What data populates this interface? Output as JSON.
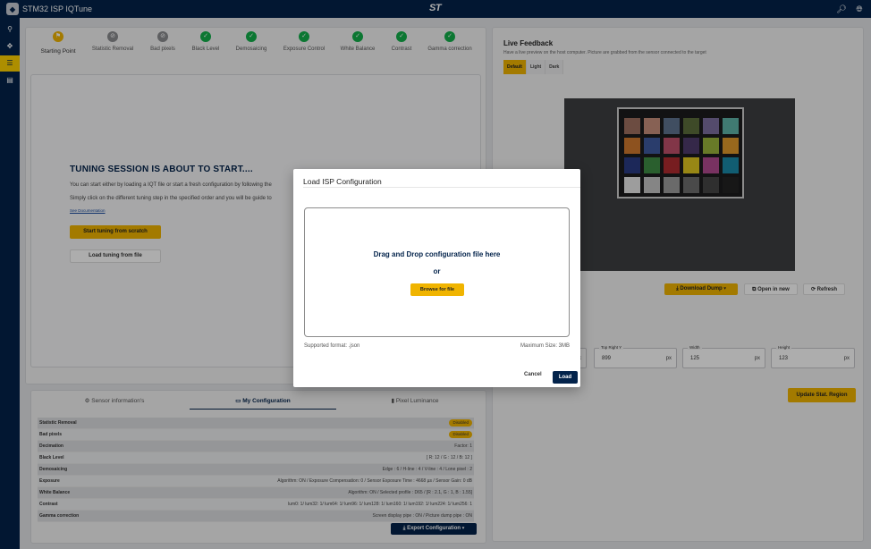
{
  "app": {
    "title": "STM32 ISP IQTune",
    "brand": "ST"
  },
  "icons": {
    "logo": "chip-icon",
    "search": "search-icon",
    "globe": "globe-icon"
  },
  "sidebar": {
    "items": [
      {
        "icon": "usb-icon"
      },
      {
        "icon": "bug-icon"
      },
      {
        "icon": "tune-icon",
        "active": true
      },
      {
        "icon": "document-icon"
      }
    ]
  },
  "steps": [
    {
      "label": "Starting Point",
      "state": "current"
    },
    {
      "label": "Statistic Removal",
      "state": "disabled"
    },
    {
      "label": "Bad pixels",
      "state": "disabled"
    },
    {
      "label": "Black Level",
      "state": "done"
    },
    {
      "label": "Demosaicing",
      "state": "done"
    },
    {
      "label": "Exposure Control",
      "state": "done"
    },
    {
      "label": "White Balance",
      "state": "done"
    },
    {
      "label": "Contrast",
      "state": "done"
    },
    {
      "label": "Gamma correction",
      "state": "done"
    }
  ],
  "welcome": {
    "title": "TUNING SESSION IS ABOUT TO START....",
    "line1": "You can start either by loading a IQT file or start a fresh configuration by following the",
    "line2": "Simply click on the different tuning step in the specified order and you will be guide to",
    "see_doc": "See Documentation",
    "start_btn": "Start tuning from scratch",
    "load_btn": "Load tuning from file"
  },
  "tabs": [
    {
      "label": "Sensor information's",
      "icon": "gear-icon"
    },
    {
      "label": "My Configuration",
      "icon": "monitor-icon",
      "active": true
    },
    {
      "label": "Pixel Luminance",
      "icon": "bar-chart-icon"
    }
  ],
  "config": [
    {
      "key": "Statistic Removal",
      "badge": "Disabled"
    },
    {
      "key": "Bad pixels",
      "badge": "Disabled"
    },
    {
      "key": "Decimation",
      "value": "Factor: 1"
    },
    {
      "key": "Black Level",
      "value": "[ R: 12 / G : 12 / B: 12 ]"
    },
    {
      "key": "Demosaicing",
      "value": "Edge : 6 / H-line : 4 / V-line : 4 / Lone pixel : 2"
    },
    {
      "key": "Exposure",
      "value": "Algorithm: ON / Exposure Compensation: 0 / Sensor Exposure Time : 4668 µs / Sensor Gain: 0 dB"
    },
    {
      "key": "White Balance",
      "value": "Algorithm: ON / Selected profile : D65 / [R : 2.1, G : 1, B : 1.55]"
    },
    {
      "key": "Contrast",
      "value": "lum0: 1/ lum32: 1/ lum64: 1/ lum96: 1/ lum128: 1/ lum160: 1/ lum192: 1/ lum224: 1/ lum256: 1"
    },
    {
      "key": "Gamma correction",
      "value": "Screen display pipe : ON / Picture dump pipe : ON"
    }
  ],
  "export_btn": "Export Configuration",
  "live": {
    "title": "Live Feedback",
    "subtitle": "Have a live preview on the host computer. Picture are grabbed from the sensor connected to the target",
    "modes": [
      "Default",
      "Light",
      "Dark"
    ],
    "download_btn": "Download Dump",
    "open_btn": "Open in new",
    "refresh_btn": "Refresh",
    "fields": [
      {
        "label": "",
        "value": "",
        "unit": "px"
      },
      {
        "label": "Top Right Y",
        "value": "899",
        "unit": "px"
      },
      {
        "label": "Width",
        "value": "125",
        "unit": "px"
      },
      {
        "label": "Height",
        "value": "123",
        "unit": "px"
      }
    ],
    "update_btn": "Update Stat. Region",
    "swatches": [
      "#a07060",
      "#c8907c",
      "#5f7390",
      "#5c6e3c",
      "#7c6fa0",
      "#5fb4a8",
      "#d07a2e",
      "#3e5aa0",
      "#c0506a",
      "#4f3b6c",
      "#9ab43c",
      "#e09a2c",
      "#2a3c84",
      "#3f8c44",
      "#b02c30",
      "#e0c820",
      "#b24a90",
      "#1a8aa8",
      "#e8e8e8",
      "#c4c4c4",
      "#9c9c9c",
      "#6e6e6e",
      "#464646",
      "#222222"
    ]
  },
  "dialog": {
    "title": "Load ISP Configuration",
    "drop_text": "Drag and Drop configuration file here",
    "or_text": "or",
    "browse_btn": "Browse for file",
    "supported": "Supported format: .json",
    "max_size": "Maximum Size: 3MB",
    "cancel": "Cancel",
    "load": "Load"
  }
}
